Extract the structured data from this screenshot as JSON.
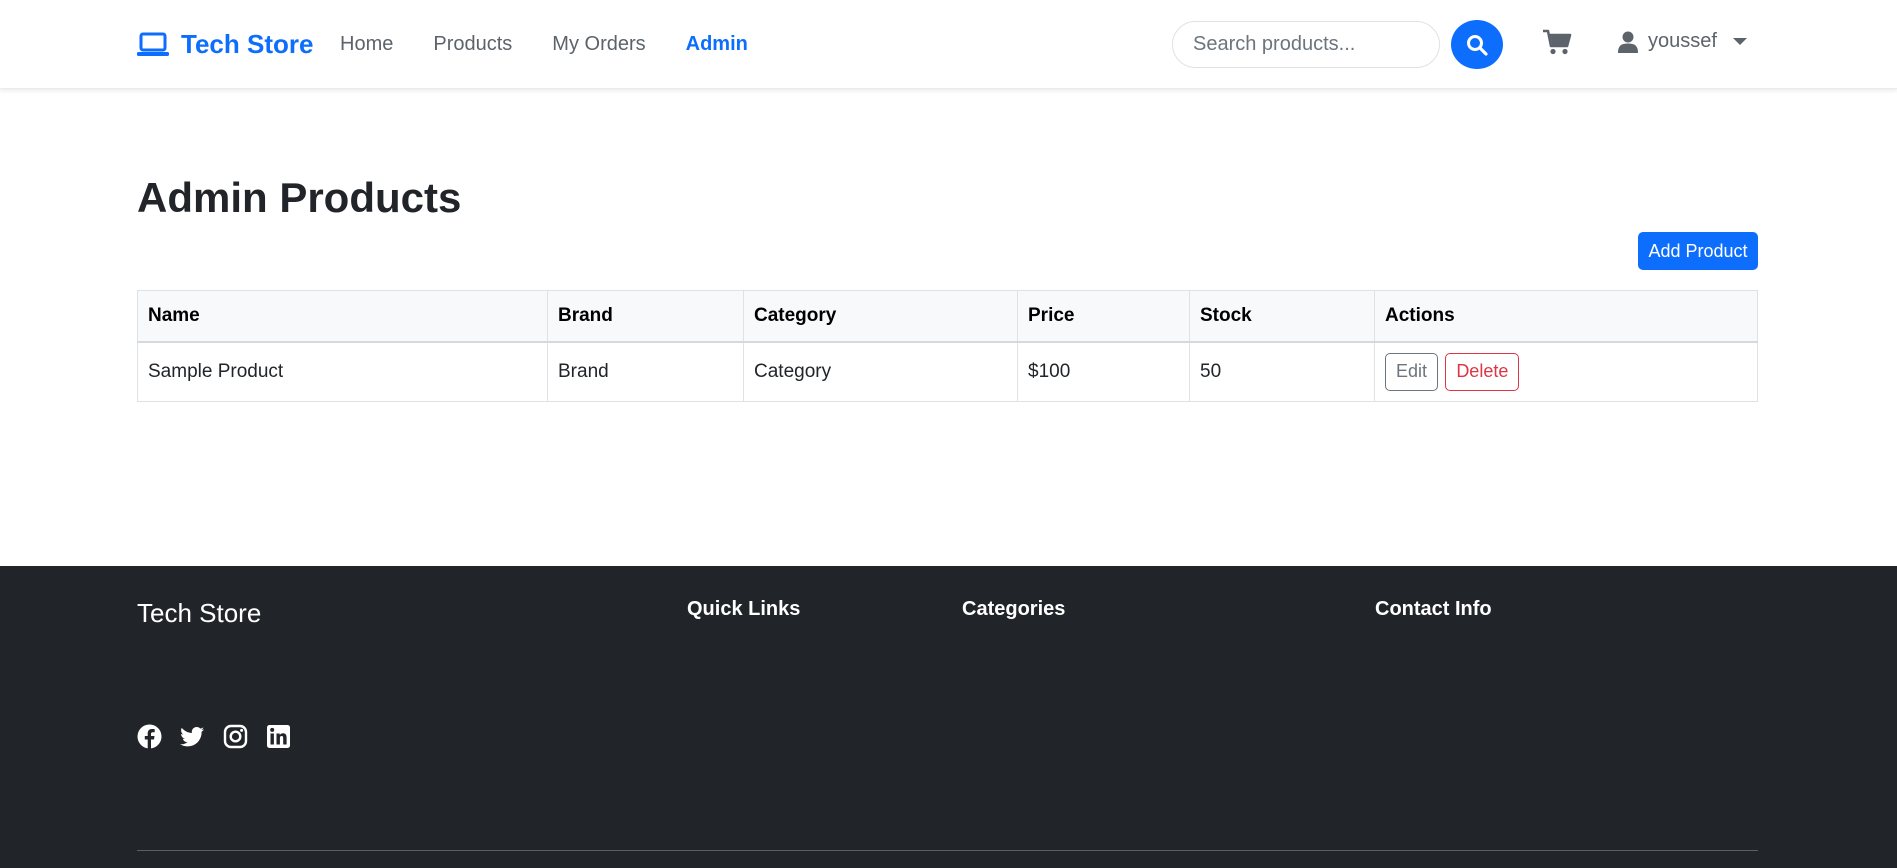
{
  "navbar": {
    "brand": "Tech Store",
    "links": [
      {
        "label": "Home",
        "active": false
      },
      {
        "label": "Products",
        "active": false
      },
      {
        "label": "My Orders",
        "active": false
      },
      {
        "label": "Admin",
        "active": true
      }
    ],
    "search_placeholder": "Search products...",
    "user_name": "youssef",
    "icons": {
      "brand": "laptop-icon",
      "search": "search-icon",
      "cart": "cart-icon",
      "user": "person-icon",
      "dropdown": "caret-down-icon"
    }
  },
  "main": {
    "title": "Admin Products",
    "add_button": "Add Product",
    "table": {
      "headers": [
        "Name",
        "Brand",
        "Category",
        "Price",
        "Stock",
        "Actions"
      ],
      "rows": [
        {
          "name": "Sample Product",
          "brand": "Brand",
          "category": "Category",
          "price": "$100",
          "stock": "50",
          "edit": "Edit",
          "delete": "Delete"
        }
      ]
    }
  },
  "footer": {
    "brand": "Tech Store",
    "headings": [
      "Quick Links",
      "Categories",
      "Contact Info"
    ],
    "socials": [
      "facebook-icon",
      "twitter-icon",
      "instagram-icon",
      "linkedin-icon"
    ]
  },
  "colors": {
    "primary": "#0d6efd",
    "danger": "#dc3545",
    "secondary": "#6c757d",
    "footer_bg": "#212529"
  }
}
